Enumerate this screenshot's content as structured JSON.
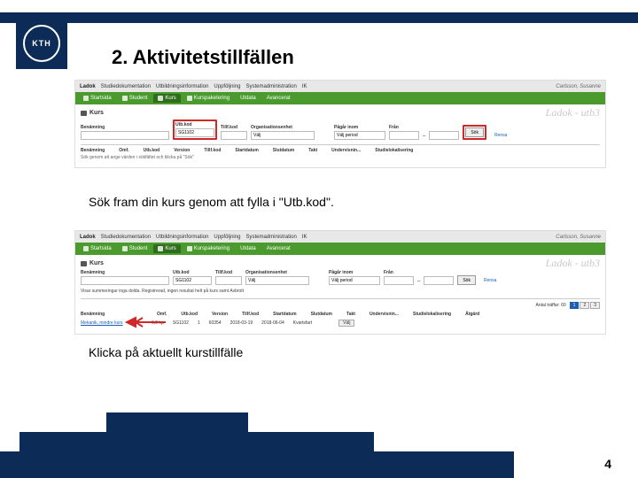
{
  "logo_text": "KTH",
  "title": "2. Aktivitetstillfällen",
  "caption1": "Sök fram din kurs genom att fylla i \"Utb.kod\".",
  "caption2": "Klicka på aktuellt kurstillfälle",
  "page_number": "4",
  "watermark": "Ladok - utb3",
  "app": {
    "brand": "Ladok",
    "menu": [
      "Studiedokumentation",
      "Utbildningsinformation",
      "Uppföljning",
      "Systemadministration",
      "IK"
    ],
    "user": "Carlsson, Susanne"
  },
  "tabs": [
    "Startsida",
    "Student",
    "Kurs",
    "Kurspaketering",
    "Utdata",
    "Avancerat"
  ],
  "section": "Kurs",
  "search": {
    "benamning_label": "Benämning",
    "kod_label": "Utb.kod",
    "kod_value": "SG1102",
    "tf_label": "Tillf.kod",
    "org_label": "Organisationsenhet",
    "org_value": "Välj",
    "pagar_label": "Pågår inom",
    "pagar_value": "Välj period",
    "fran_label": "Från",
    "sok": "Sök",
    "rensa": "Rensa"
  },
  "thead": [
    "Benämning",
    "Omf.",
    "Utb.kod",
    "Version",
    "Tillf.kod",
    "Startdatum",
    "Slutdatum",
    "Takt",
    "Undervisnin...",
    "Studielokalisering",
    "Åtgärd"
  ],
  "hint": "Sök genom att ange värden i sökfältet och klicka på \"Sök\"",
  "panel2": {
    "summary": "Visar summeringar inga dolda. Registrerad, ingen resultat helt på kurs samt Avbrott",
    "count_label": "Antal träffar: 60",
    "pages": [
      "1",
      "2",
      "3"
    ],
    "row": {
      "name": "Mekanik, mindre kurs",
      "omf": "6,0 hp",
      "kod": "SG1102",
      "ver": "1",
      "tk": "60354",
      "start": "2018-03-19",
      "slut": "2018-06-04",
      "takt": "Kvartsfart",
      "plats": "",
      "atgard": "Välj"
    }
  }
}
